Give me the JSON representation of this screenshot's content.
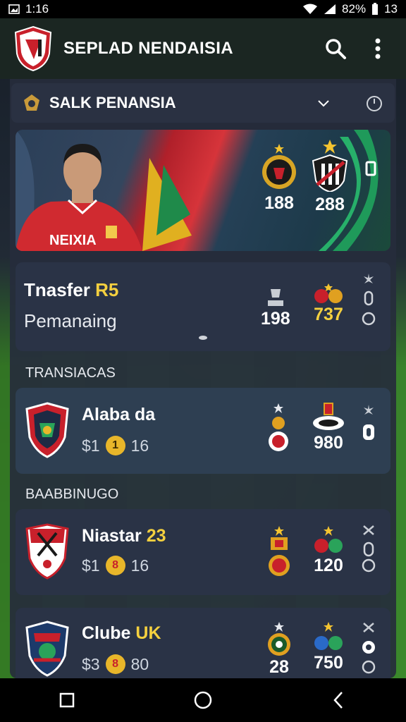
{
  "status": {
    "time_left": "1:16",
    "battery": "82%",
    "time_right": "13"
  },
  "appbar": {
    "title": "SEPLAD NENDAISIA"
  },
  "subbar": {
    "title": "SALK PENANSIA"
  },
  "hero": {
    "shirt_text": "NEIXIA",
    "stat_1": "188",
    "stat_2": "288"
  },
  "transfer_card": {
    "title_prefix": "Tnasfer ",
    "title_accent": "R5",
    "subtitle": "Pemanaing",
    "stat_1": "198",
    "stat_2": "737"
  },
  "sections": {
    "transactions": "TRANSIACAS",
    "second": "BAABBINUGO"
  },
  "clubs": [
    {
      "name": "Alaba da",
      "price": "$1",
      "coin": "1",
      "amount": "16",
      "stat": "980"
    },
    {
      "name_prefix": "Niastar ",
      "name_accent": "23",
      "price": "$1",
      "coin": "8",
      "amount": "16",
      "stat": "120"
    },
    {
      "name_prefix": "Clube ",
      "name_accent": "UK",
      "price": "$3",
      "coin": "8",
      "amount": "80",
      "stat_1": "28",
      "stat_2": "750"
    }
  ],
  "colors": {
    "accent_yellow": "#f4d03f",
    "card_bg": "#2a3346",
    "red": "#c8202b"
  }
}
